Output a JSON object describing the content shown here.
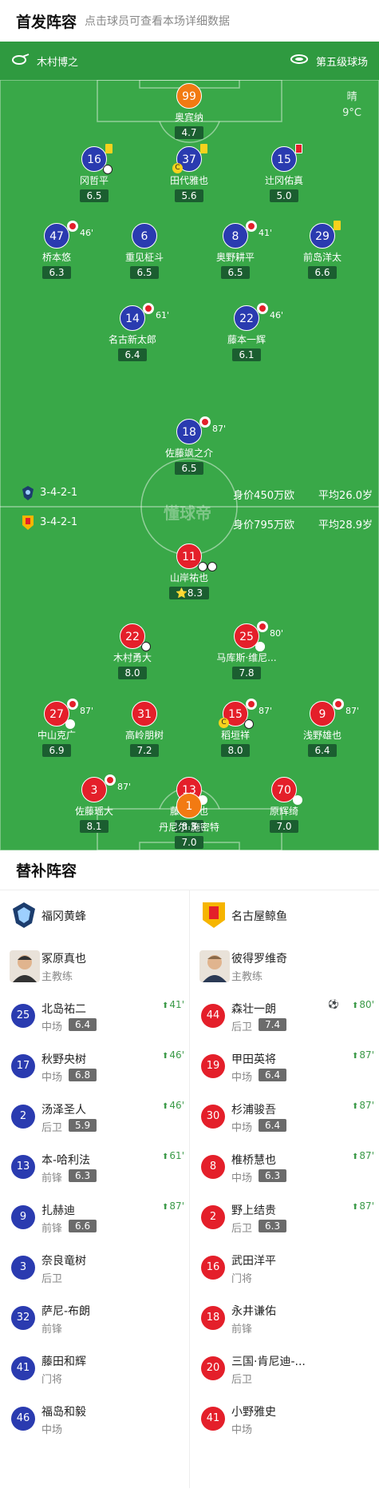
{
  "header": {
    "title": "首发阵容",
    "hint": "点击球员可查看本场详细数据"
  },
  "pitch": {
    "referee": "木村博之",
    "stadium": "第五级球场",
    "weather": {
      "condition": "晴",
      "temp": "9°C"
    },
    "watermark": "懂球帝",
    "home": {
      "formation": "3-4-2-1",
      "value": "身价450万欧",
      "age": "平均26.0岁"
    },
    "away": {
      "formation": "3-4-2-1",
      "value": "身价795万欧",
      "age": "平均28.9岁"
    }
  },
  "home_players": [
    {
      "num": "99",
      "name": "奥宾纳",
      "rating": "4.7"
    },
    {
      "num": "16",
      "name": "冈哲平",
      "rating": "6.5"
    },
    {
      "num": "37",
      "name": "田代雅也",
      "rating": "5.6"
    },
    {
      "num": "15",
      "name": "辻冈佑真",
      "rating": "5.0"
    },
    {
      "num": "47",
      "name": "桥本悠",
      "rating": "6.3",
      "sub": "46'"
    },
    {
      "num": "6",
      "name": "重见柾斗",
      "rating": "6.5"
    },
    {
      "num": "8",
      "name": "奥野耕平",
      "rating": "6.5",
      "sub": "41'"
    },
    {
      "num": "29",
      "name": "前岛洋太",
      "rating": "6.6"
    },
    {
      "num": "14",
      "name": "名古新太郎",
      "rating": "6.4",
      "sub": "61'"
    },
    {
      "num": "22",
      "name": "藤本一辉",
      "rating": "6.1",
      "sub": "46'"
    },
    {
      "num": "18",
      "name": "佐藤飒之介",
      "rating": "6.5",
      "sub": "87'"
    }
  ],
  "away_players": [
    {
      "num": "11",
      "name": "山岸祐也",
      "rating": "8.3"
    },
    {
      "num": "22",
      "name": "木村勇大",
      "rating": "8.0"
    },
    {
      "num": "25",
      "name": "马库斯·维尼...",
      "rating": "7.8",
      "sub": "80'"
    },
    {
      "num": "27",
      "name": "中山克广",
      "rating": "6.9",
      "sub": "87'"
    },
    {
      "num": "31",
      "name": "高岭朋树",
      "rating": "7.2"
    },
    {
      "num": "15",
      "name": "稻垣祥",
      "rating": "8.0",
      "sub": "87'"
    },
    {
      "num": "9",
      "name": "浅野雄也",
      "rating": "6.4",
      "sub": "87'"
    },
    {
      "num": "3",
      "name": "佐藤瑶大",
      "rating": "8.1",
      "sub": "87'"
    },
    {
      "num": "13",
      "name": "藤井阳也",
      "rating": "8.3"
    },
    {
      "num": "70",
      "name": "原辉绮",
      "rating": "7.0"
    },
    {
      "num": "1",
      "name": "丹尼尔·施密特",
      "rating": "7.0"
    }
  ],
  "subs": {
    "title": "替补阵容",
    "home": {
      "team": "福冈黄蜂",
      "coach": {
        "name": "冢原真也",
        "role": "主教练"
      },
      "players": [
        {
          "num": "25",
          "name": "北岛祐二",
          "pos": "中场",
          "rating": "6.4",
          "in": "41'"
        },
        {
          "num": "17",
          "name": "秋野央树",
          "pos": "中场",
          "rating": "6.8",
          "in": "46'"
        },
        {
          "num": "2",
          "name": "汤泽圣人",
          "pos": "后卫",
          "rating": "5.9",
          "in": "46'"
        },
        {
          "num": "13",
          "name": "本-哈利法",
          "pos": "前锋",
          "rating": "6.3",
          "in": "61'"
        },
        {
          "num": "9",
          "name": "扎赫迪",
          "pos": "前锋",
          "rating": "6.6",
          "in": "87'"
        },
        {
          "num": "3",
          "name": "奈良竜树",
          "pos": "后卫"
        },
        {
          "num": "32",
          "name": "萨尼-布朗",
          "pos": "前锋"
        },
        {
          "num": "41",
          "name": "藤田和辉",
          "pos": "门将"
        },
        {
          "num": "46",
          "name": "福岛和毅",
          "pos": "中场"
        }
      ]
    },
    "away": {
      "team": "名古屋鲸鱼",
      "coach": {
        "name": "彼得罗维奇",
        "role": "主教练"
      },
      "players": [
        {
          "num": "44",
          "name": "森壮一朗",
          "pos": "后卫",
          "rating": "7.4",
          "in": "80'"
        },
        {
          "num": "19",
          "name": "甲田英将",
          "pos": "中场",
          "rating": "6.4",
          "in": "87'"
        },
        {
          "num": "30",
          "name": "杉浦骏吾",
          "pos": "中场",
          "rating": "6.4",
          "in": "87'"
        },
        {
          "num": "8",
          "name": "椎桥慧也",
          "pos": "中场",
          "rating": "6.3",
          "in": "87'"
        },
        {
          "num": "2",
          "name": "野上结贵",
          "pos": "后卫",
          "rating": "6.3",
          "in": "87'"
        },
        {
          "num": "16",
          "name": "武田洋平",
          "pos": "门将"
        },
        {
          "num": "18",
          "name": "永井谦佑",
          "pos": "前锋"
        },
        {
          "num": "20",
          "name": "三国·肯尼迪-...",
          "pos": "后卫"
        },
        {
          "num": "41",
          "name": "小野雅史",
          "pos": "中场"
        }
      ]
    }
  },
  "colors": {
    "pitch": "#39a848",
    "home": "#2a3bb0",
    "away": "#e41f2a",
    "gk": "#f27a12"
  }
}
